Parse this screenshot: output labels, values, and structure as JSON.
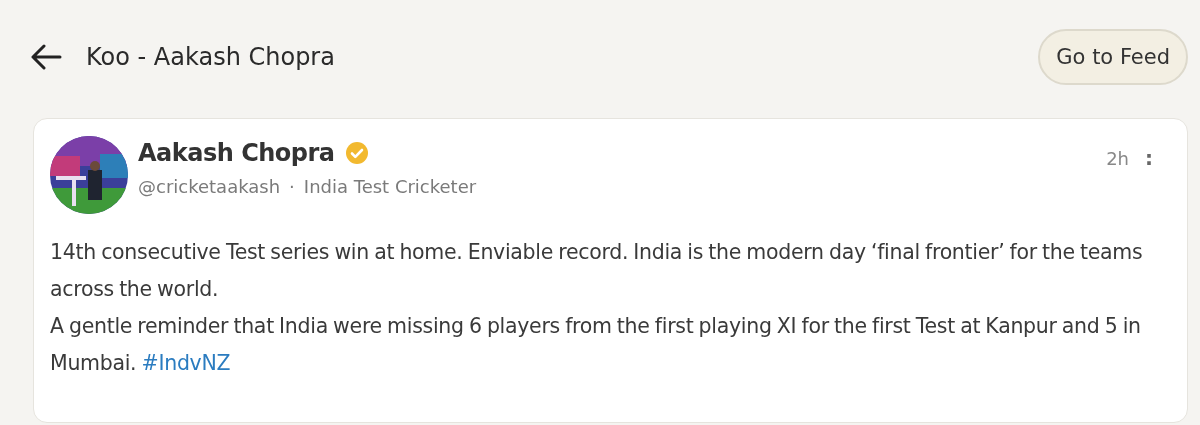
{
  "header": {
    "title": "Koo - Aakash Chopra",
    "button": "Go to Feed"
  },
  "post": {
    "author": "Aakash Chopra",
    "verified": true,
    "handle": "@cricketaakash",
    "separator": "·",
    "bio": "India Test Cricketer",
    "time": "2h",
    "menu": ":",
    "paragraphs": [
      {
        "text": "14th consecutive Test series win at home. Enviable record. India is the modern day ‘final frontier’ for the teams across the world."
      },
      {
        "text": "A gentle reminder that India were missing 6 players from the first playing XI for the first Test at Kanpur and 5 in Mumbai.",
        "hashtag": "#IndvNZ"
      }
    ]
  }
}
